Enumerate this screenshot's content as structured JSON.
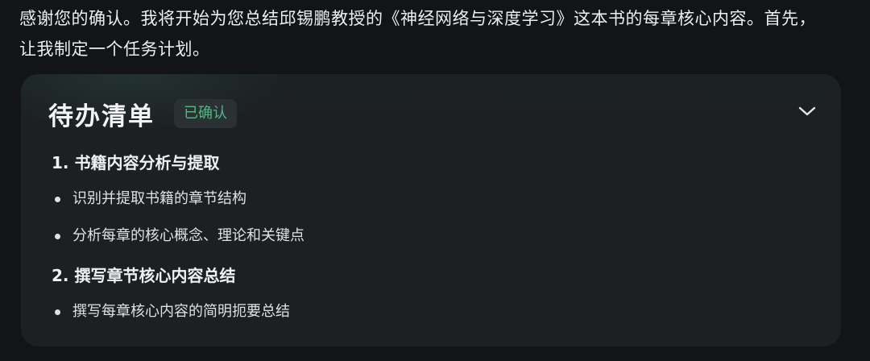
{
  "message": {
    "intro_text": "感谢您的确认。我将开始为您总结邱锡鹏教授的《神经网络与深度学习》这本书的每章核心内容。首先，让我制定一个任务计划。"
  },
  "todo_card": {
    "title": "待办清单",
    "status": "已确认",
    "status_color": "#58b587",
    "toggle_icon": "chevron-down-icon",
    "sections": [
      {
        "title": "1. 书籍内容分析与提取",
        "tasks": [
          "识别并提取书籍的章节结构",
          "分析每章的核心概念、理论和关键点"
        ]
      },
      {
        "title": "2. 撰写章节核心内容总结",
        "tasks": [
          "撰写每章核心内容的简明扼要总结"
        ]
      }
    ]
  }
}
